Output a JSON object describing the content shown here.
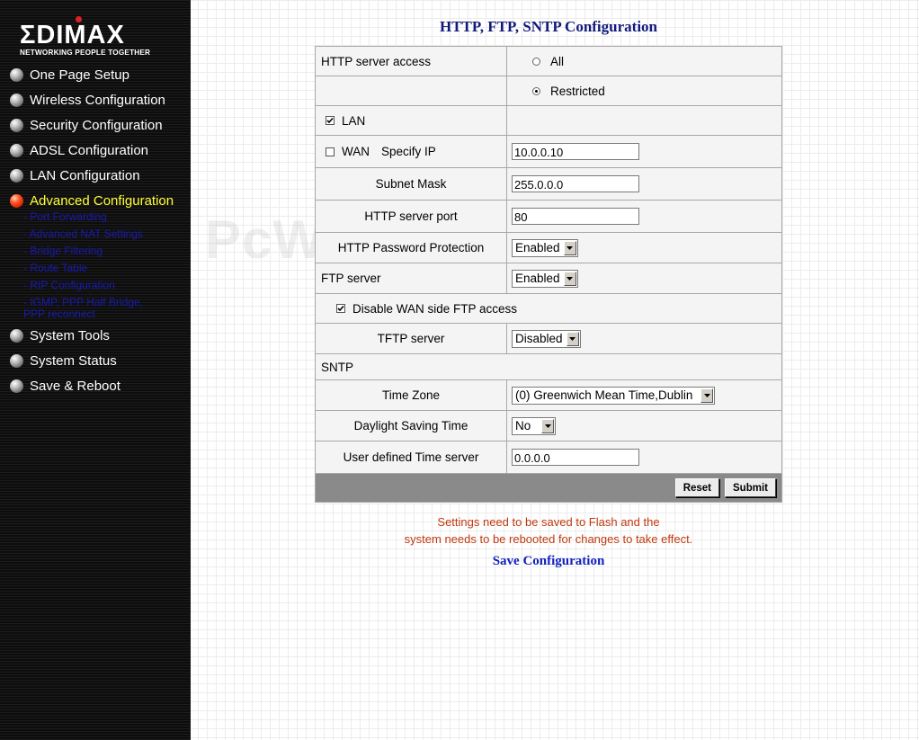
{
  "logo": {
    "word": "ΣDIMAX",
    "tagline": "NETWORKING PEOPLE TOGETHER"
  },
  "sidebar": {
    "items": [
      {
        "label": "One Page Setup",
        "active": false
      },
      {
        "label": "Wireless Configuration",
        "active": false
      },
      {
        "label": "Security Configuration",
        "active": false
      },
      {
        "label": "ADSL Configuration",
        "active": false
      },
      {
        "label": "LAN Configuration",
        "active": false
      },
      {
        "label": "Advanced Configuration",
        "active": true
      }
    ],
    "subitems": [
      "- Port Forwarding",
      "- Advanced NAT Settings",
      "- Bridge Filtering",
      "- Route Table",
      "- RIP Configuration",
      "- IGMP, PPP Half Bridge, PPP reconnect"
    ],
    "items_after": [
      {
        "label": "System Tools"
      },
      {
        "label": "System Status"
      },
      {
        "label": "Save & Reboot"
      }
    ],
    "colors": {
      "active": "#ffff33",
      "inactive": "#ffffff",
      "sublink": "#1a1ab0"
    }
  },
  "page": {
    "title": "HTTP, FTP, SNTP Configuration"
  },
  "form": {
    "http_access_label": "HTTP server access",
    "http_access_all": "All",
    "http_access_restricted": "Restricted",
    "http_access_selected": "Restricted",
    "lan_label": "LAN",
    "lan_checked": true,
    "wan_label": "WAN",
    "wan_checked": false,
    "specify_ip_label": "Specify IP",
    "specify_ip_value": "10.0.0.10",
    "subnet_mask_label": "Subnet Mask",
    "subnet_mask_value": "255.0.0.0",
    "http_port_label": "HTTP server port",
    "http_port_value": "80",
    "http_pw_label": "HTTP Password Protection",
    "http_pw_value": "Enabled",
    "ftp_server_label": "FTP server",
    "ftp_server_value": "Enabled",
    "disable_wan_ftp_label": "Disable WAN side FTP access",
    "disable_wan_ftp_checked": true,
    "tftp_label": "TFTP server",
    "tftp_value": "Disabled",
    "sntp_label": "SNTP",
    "timezone_label": "Time Zone",
    "timezone_value": "(0) Greenwich Mean Time,Dublin",
    "dst_label": "Daylight Saving Time",
    "dst_value": "No",
    "time_server_label": "User defined Time server",
    "time_server_value": "0.0.0.0",
    "reset_label": "Reset",
    "submit_label": "Submit"
  },
  "notice": {
    "line1": "Settings need to be saved to Flash and the",
    "line2": "system needs to be rebooted for changes to take effect.",
    "color": "#c0390e"
  },
  "save_link": "Save Configuration",
  "watermark": "PcWinTech.com",
  "icons": {
    "menu_bullet": "sphere-bullet-icon",
    "active_bullet": "red-sphere-bullet-icon",
    "dropdown": "chevron-down-icon",
    "check": "check-icon"
  }
}
